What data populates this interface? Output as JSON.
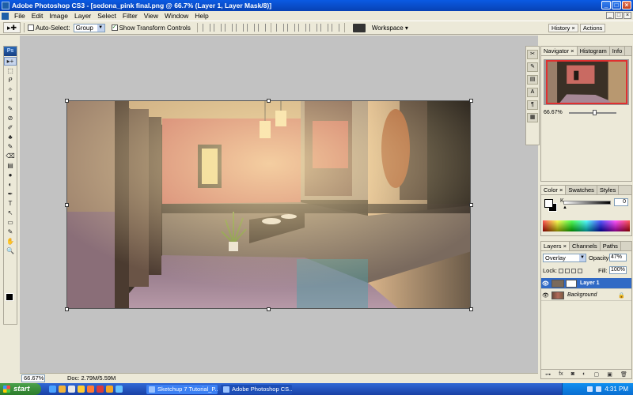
{
  "window": {
    "title": "Adobe Photoshop CS3 - [sedona_pink final.png @ 66.7% (Layer 1, Layer Mask/8)]",
    "min": "_",
    "max": "□",
    "close": "×"
  },
  "menu": [
    "File",
    "Edit",
    "Image",
    "Layer",
    "Select",
    "Filter",
    "View",
    "Window",
    "Help"
  ],
  "options": {
    "auto_select_label": "Auto-Select:",
    "auto_select_value": "Group",
    "show_transform_label": "Show Transform Controls",
    "workspace_label": "Workspace ▾"
  },
  "history_tabs": [
    "History ×",
    "Actions"
  ],
  "toolbox": {
    "logo": "Ps",
    "tools": [
      "▸+",
      "⬚",
      "ᑭ",
      "✧",
      "⌗",
      "✎",
      "⊘",
      "✐",
      "♣",
      "✎",
      "⌫",
      "▤",
      "●",
      "◐",
      "✒",
      "T",
      "↖",
      "▭",
      "✎",
      "✋",
      "🔍"
    ]
  },
  "status": {
    "zoom": "66.67%",
    "doc": "Doc: 2.79M/5.59M"
  },
  "navigator": {
    "tabs": [
      "Navigator ×",
      "Histogram",
      "Info"
    ],
    "zoom": "66.67%"
  },
  "color": {
    "tabs": [
      "Color ×",
      "Swatches",
      "Styles"
    ],
    "k_label": "K",
    "k_value": "0",
    "k_percent": "%"
  },
  "layers": {
    "tabs": [
      "Layers ×",
      "Channels",
      "Paths"
    ],
    "blend": "Overlay",
    "opacity_label": "Opacity:",
    "opacity": "47%",
    "lock_label": "Lock:",
    "fill_label": "Fill:",
    "fill": "100%",
    "items": [
      {
        "name": "Layer 1",
        "visible": "👁"
      },
      {
        "name": "Background",
        "visible": "👁"
      }
    ],
    "bottom_icons": [
      "⊶",
      "fx",
      "◙",
      "◐",
      "▢",
      "▣",
      "🗑"
    ]
  },
  "taskbar": {
    "start": "start",
    "tasks": [
      "Sketchup 7 Tutorial_P...",
      "Adobe Photoshop CS..."
    ],
    "clock": "4:31 PM"
  }
}
